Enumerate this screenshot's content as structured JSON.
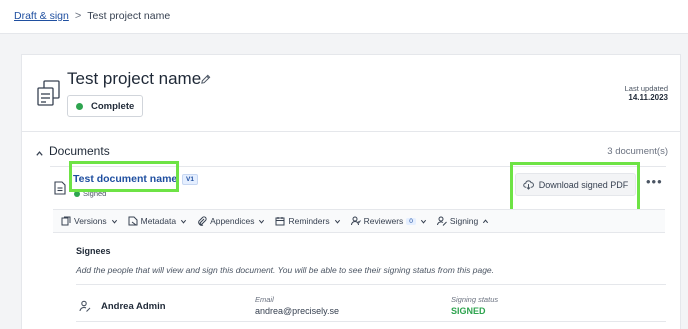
{
  "breadcrumb": {
    "parent": "Draft & sign",
    "separator": ">",
    "current": "Test project name"
  },
  "project": {
    "title": "Test project name",
    "status": "Complete",
    "last_updated_label": "Last updated",
    "last_updated_value": "14.11.2023"
  },
  "documents": {
    "title": "Documents",
    "count": "3 document(s)",
    "item": {
      "name": "Test document name",
      "version": "V1",
      "status": "Signed",
      "download_label": "Download signed PDF",
      "more_label": "•••"
    }
  },
  "toolbar": {
    "versions": "Versions",
    "metadata": "Metadata",
    "appendices": "Appendices",
    "reminders": "Reminders",
    "reviewers": "Reviewers",
    "reviewers_count": "0",
    "signing": "Signing"
  },
  "signees": {
    "title": "Signees",
    "description": "Add the people that will view and sign this document. You will be able to see their signing status from this page.",
    "rows": [
      {
        "name": "Andrea Admin",
        "email_label": "Email",
        "email": "andrea@precisely.se",
        "status_label": "Signing status",
        "status": "SIGNED"
      }
    ]
  },
  "colors": {
    "accent": "#1f4fa0",
    "success": "#2ea44f",
    "highlight": "#6ee345"
  }
}
